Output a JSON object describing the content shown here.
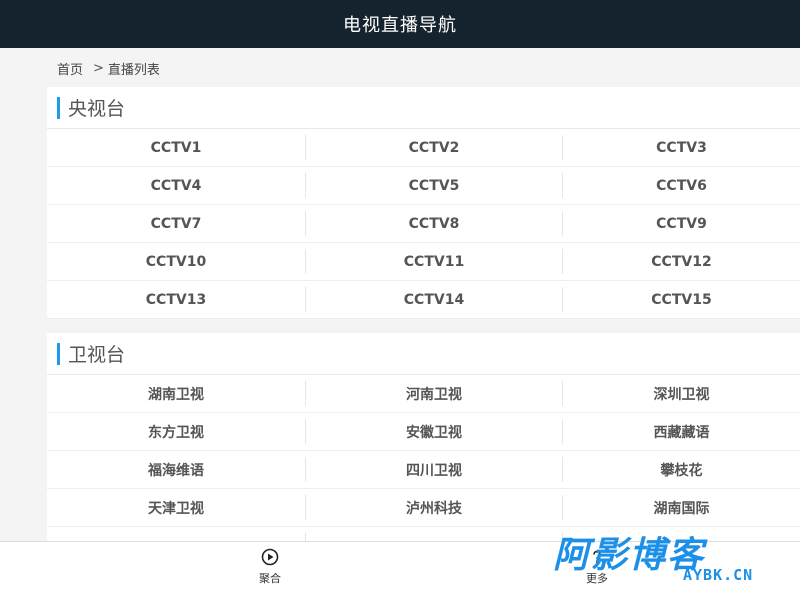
{
  "header": {
    "title": "电视直播导航"
  },
  "breadcrumb": {
    "home": "首页",
    "separator": ">",
    "current": "直播列表"
  },
  "sections": [
    {
      "title": "央视台",
      "channels": [
        "CCTV1",
        "CCTV2",
        "CCTV3",
        "CCTV4",
        "CCTV5",
        "CCTV6",
        "CCTV7",
        "CCTV8",
        "CCTV9",
        "CCTV10",
        "CCTV11",
        "CCTV12",
        "CCTV13",
        "CCTV14",
        "CCTV15"
      ]
    },
    {
      "title": "卫视台",
      "channels": [
        "湖南卫视",
        "河南卫视",
        "深圳卫视",
        "东方卫视",
        "安徽卫视",
        "西藏藏语",
        "福海维语",
        "四川卫视",
        "攀枝花",
        "天津卫视",
        "泸州科技",
        "湖南国际"
      ]
    }
  ],
  "bottom_nav": {
    "items": [
      {
        "label": "聚合",
        "icon": "play-circle-icon"
      },
      {
        "label": "更多",
        "icon": "question-icon"
      }
    ]
  },
  "watermark": {
    "text": "阿影博客",
    "domain": "AYBK.CN"
  },
  "colors": {
    "header_bg": "#15232e",
    "accent": "#1e9be6",
    "watermark": "#1c90e8"
  }
}
